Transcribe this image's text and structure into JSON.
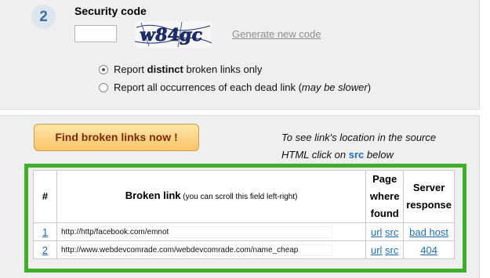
{
  "step": {
    "number": "2",
    "title": "Security code"
  },
  "security": {
    "input_value": "",
    "captcha_text": "w84gc",
    "generate_link": "Generate new code"
  },
  "options": {
    "distinct": {
      "prefix": "Report ",
      "bold": "distinct",
      "suffix": " broken links only",
      "checked": true
    },
    "all": {
      "prefix": "Report all occurrences of each dead link (",
      "italic": "may be slower",
      "suffix": ")",
      "checked": false
    }
  },
  "find_button": "Find broken links now !",
  "hint": {
    "line1": "To see link's location in the source",
    "line2_prefix": "HTML click on ",
    "src": "src",
    "line2_suffix": " below"
  },
  "table": {
    "headers": {
      "num": "#",
      "link": "Broken link",
      "link_note": " (you can scroll this field left-right)",
      "page_l1": "Page",
      "page_l2": "where",
      "page_l3": "found",
      "server_l1": "Server",
      "server_l2": "response"
    },
    "rows": [
      {
        "num": "1",
        "url": "http://http/facebook.com/emnot",
        "url_link": "url",
        "src_link": "src",
        "response": "bad host"
      },
      {
        "num": "2",
        "url": "http://www.webdevcomrade.com/webdevcomrade.com/name_cheap",
        "url_link": "url",
        "src_link": "src",
        "response": "404"
      }
    ]
  },
  "colors": {
    "accent_green": "#3fae28",
    "button_text": "#7a2a08",
    "link_blue": "#1f6db6"
  }
}
